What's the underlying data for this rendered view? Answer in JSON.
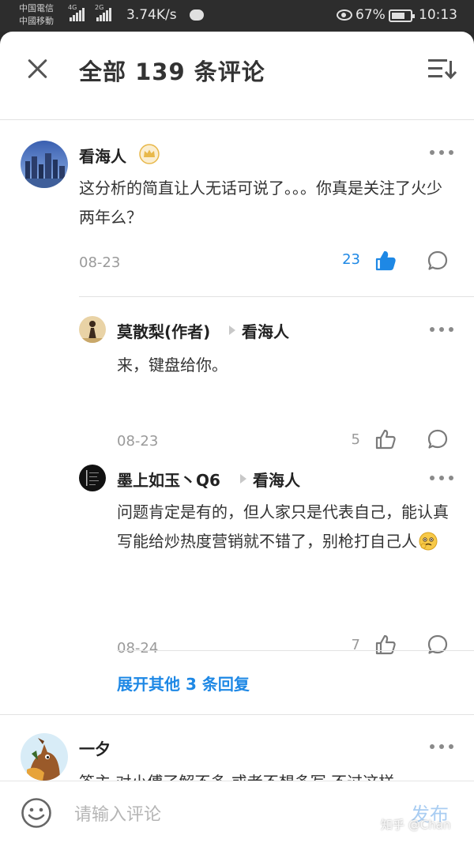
{
  "status_bar": {
    "carrier_1": "中国電信",
    "carrier_2": "中國移動",
    "net_1": "4G",
    "net_2": "2G",
    "speed": "3.74K/s",
    "battery": "67%",
    "time": "10:13"
  },
  "header": {
    "title": "全部 139 条评论"
  },
  "comments": [
    {
      "user": "看海人",
      "text": "这分析的简直让人无话可说了。。。你真是关注了火少两年么？",
      "date": "08-23",
      "likes": "23"
    },
    {
      "user": "莫散梨(作者)",
      "reply_to": "看海人",
      "text": "来，键盘给你。",
      "date": "08-23",
      "likes": "5"
    },
    {
      "user": "墨上如玉丶Q6",
      "reply_to": "看海人",
      "text": "问题肯定是有的，但人家只是代表自己，能认真写能给炒热度营销就不错了，别枪打自己人",
      "date": "08-24",
      "likes": "7"
    },
    {
      "user": "一夕",
      "text": "答主 对小傅了解不多 或者不想多写 不过这样"
    }
  ],
  "expand_replies": "展开其他 3 条回复",
  "bottom_bar": {
    "placeholder": "请输入评论",
    "publish": "发布",
    "watermark": "知乎 @Chan"
  },
  "colors": {
    "accent": "#1e88e5",
    "status_bar_bg": "#2d2d2d",
    "badge": "#e8b84a"
  }
}
